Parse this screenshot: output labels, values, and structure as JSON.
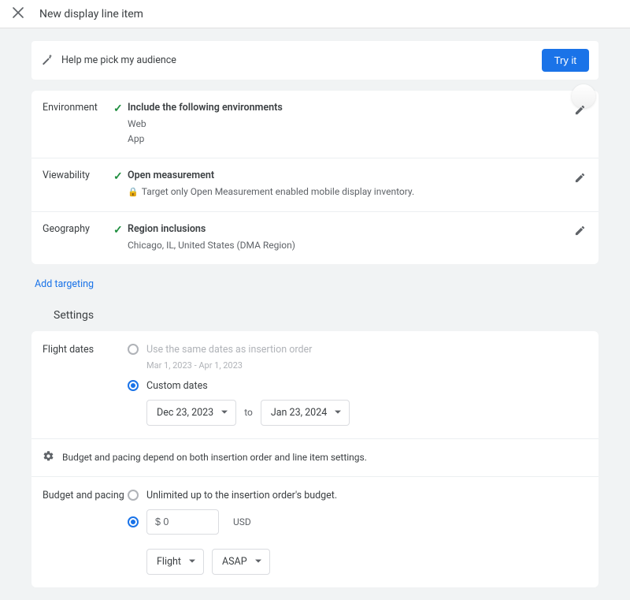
{
  "header": {
    "title": "New display line item"
  },
  "audience_bar": {
    "text": "Help me pick my audience",
    "try_label": "Try it"
  },
  "targeting": {
    "environment": {
      "label": "Environment",
      "heading": "Include the following environments",
      "items": [
        "Web",
        "App"
      ]
    },
    "viewability": {
      "label": "Viewability",
      "heading": "Open measurement",
      "note": "Target only Open Measurement enabled mobile display inventory."
    },
    "geography": {
      "label": "Geography",
      "heading": "Region inclusions",
      "region": "Chicago, IL, United States (DMA Region)"
    }
  },
  "add_targeting": "Add targeting",
  "settings_title": "Settings",
  "flight_dates": {
    "label": "Flight dates",
    "same_label": "Use the same dates as insertion order",
    "same_range": "Mar 1, 2023 - Apr 1, 2023",
    "custom_label": "Custom dates",
    "start": "Dec 23, 2023",
    "to": "to",
    "end": "Jan 23, 2024"
  },
  "budget_info": "Budget and pacing depend on both insertion order and line item settings.",
  "budget": {
    "label": "Budget and pacing",
    "unlimited_label": "Unlimited up to the insertion order's budget.",
    "amount": "$ 0",
    "currency": "USD",
    "flight": "Flight",
    "asap": "ASAP"
  }
}
